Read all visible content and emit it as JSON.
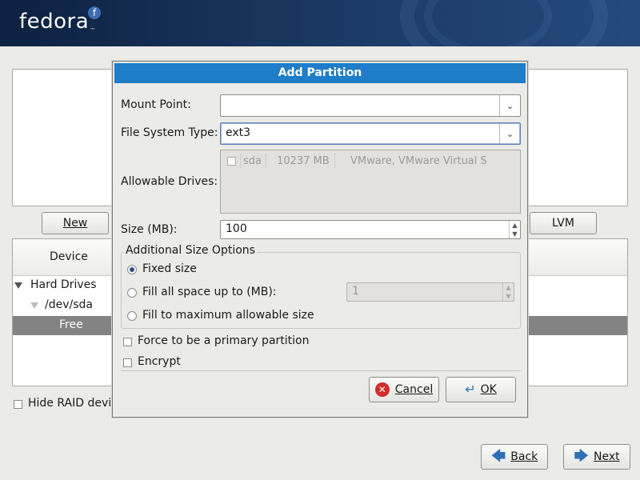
{
  "banner": {
    "logo_text": "fedora",
    "logo_mark": "f",
    "trademark": "™"
  },
  "main": {
    "buttons": {
      "new": "New",
      "lvm": "LVM"
    },
    "tree": {
      "column_header": "Device",
      "rows": [
        {
          "label": "Hard Drives"
        },
        {
          "label": "/dev/sda"
        },
        {
          "label": "Free"
        }
      ]
    },
    "hide_raid_label": "Hide RAID devic",
    "nav": {
      "back": "Back",
      "next": "Next"
    }
  },
  "dialog": {
    "title": "Add Partition",
    "mount_point": {
      "label": "Mount Point:",
      "value": ""
    },
    "fs_type": {
      "label": "File System Type:",
      "value": "ext3"
    },
    "allowable_drives": {
      "label": "Allowable Drives:",
      "drive": {
        "name": "sda",
        "size": "10237 MB",
        "model": "VMware, VMware Virtual S",
        "checked": false
      }
    },
    "size": {
      "label": "Size (MB):",
      "value": "100"
    },
    "additional_size_options": {
      "title": "Additional Size Options",
      "fixed": "Fixed size",
      "fill_up_to": "Fill all space up to (MB):",
      "fill_up_to_value": "1",
      "fill_max": "Fill to maximum allowable size",
      "selected": "fixed"
    },
    "force_primary_label": "Force to be a primary partition",
    "encrypt_label": "Encrypt",
    "buttons": {
      "cancel": "Cancel",
      "ok": "OK"
    }
  },
  "colors": {
    "title_bar": "#1f7dc9",
    "selection_row": "#838383",
    "banner": "#1c3a66"
  }
}
